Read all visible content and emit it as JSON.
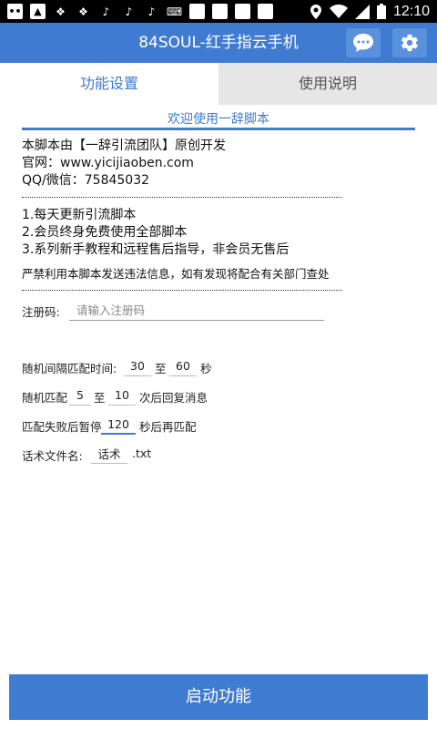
{
  "status_bar": {
    "time": "12:10",
    "left_icons": [
      "message-icon",
      "image-icon",
      "gallery-icon",
      "gallery-icon",
      "tiktok-icon",
      "tiktok-icon",
      "tiktok-icon",
      "keyboard-icon",
      "square-icon",
      "square-icon",
      "square-icon",
      "square-icon"
    ],
    "right_icons": [
      "location-icon",
      "wifi-icon",
      "signal-icon",
      "battery-icon"
    ]
  },
  "app_bar": {
    "title": "84SOUL-红手指云手机",
    "chat_icon": "chat-bubble-icon",
    "settings_icon": "gear-icon",
    "accent_color": "#3f7bd0"
  },
  "tabs": [
    {
      "label": "功能设置",
      "active": true
    },
    {
      "label": "使用说明",
      "active": false
    }
  ],
  "content": {
    "welcome": "欢迎使用一辞脚本",
    "intro_lines": [
      "本脚本由【一辞引流团队】原创开发",
      "官网：www.yicijiaoben.com",
      "QQ/微信：75845032"
    ],
    "feature_lines": [
      "1.每天更新引流脚本",
      "2.会员终身免费使用全部脚本",
      "3.系列新手教程和远程售后指导，非会员无售后"
    ],
    "warning": "严禁利用本脚本发送违法信息，如有发现将配合有关部门查处"
  },
  "form": {
    "reg_label": "注册码:",
    "reg_placeholder": "请输入注册码",
    "interval_label": "随机间隔匹配时间:",
    "interval_min": "30",
    "interval_to": "至",
    "interval_max": "60",
    "interval_unit": "秒",
    "match_label": "随机匹配",
    "match_min": "5",
    "match_to": "至",
    "match_max": "10",
    "match_suffix": "次后回复消息",
    "pause_label": "匹配失败后暂停",
    "pause_value": "120",
    "pause_suffix": "秒后再匹配",
    "file_label": "话术文件名:",
    "file_value": "话术",
    "file_ext": ".txt"
  },
  "start_button": "启动功能"
}
